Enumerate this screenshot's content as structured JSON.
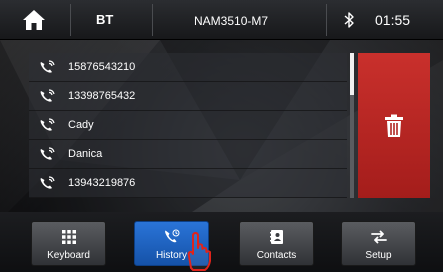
{
  "topbar": {
    "home_icon": "home-icon",
    "source_label": "BT",
    "device_name": "NAM3510-M7",
    "bluetooth_icon": "bluetooth-icon",
    "clock": "01:55"
  },
  "call_list": {
    "row_icon": "phone-call-icon",
    "items": [
      {
        "label": "15876543210"
      },
      {
        "label": "13398765432"
      },
      {
        "label": "Cady"
      },
      {
        "label": "Danica"
      },
      {
        "label": "13943219876"
      }
    ]
  },
  "delete_button": {
    "icon": "trash-icon",
    "color": "#c0302c"
  },
  "tabs": [
    {
      "label": "Keyboard",
      "icon": "keypad-icon"
    },
    {
      "label": "History",
      "icon": "call-history-icon",
      "active": true
    },
    {
      "label": "Contacts",
      "icon": "contacts-book-icon"
    },
    {
      "label": "Setup",
      "icon": "transfer-arrows-icon"
    }
  ],
  "colors": {
    "accent": "#1f63c4",
    "delete": "#c0302c"
  }
}
